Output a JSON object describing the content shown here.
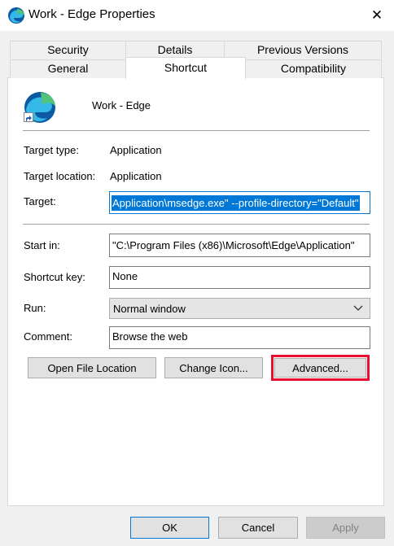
{
  "window": {
    "title": "Work - Edge Properties",
    "close_glyph": "✕",
    "icons": [
      "edge-icon",
      "close-icon",
      "shortcut-arrow-icon",
      "chevron-down-icon"
    ]
  },
  "tabs": {
    "row1": [
      "Security",
      "Details",
      "Previous Versions"
    ],
    "row2": [
      "General",
      "Shortcut",
      "Compatibility"
    ],
    "active": "Shortcut"
  },
  "shortcut": {
    "name": "Work - Edge",
    "target_type_label": "Target type:",
    "target_type_value": "Application",
    "target_location_label": "Target location:",
    "target_location_value": "Application",
    "target_label": "Target:",
    "target_value": "Application\\msedge.exe\" --profile-directory=\"Default\"",
    "start_in_label": "Start in:",
    "start_in_value": "\"C:\\Program Files (x86)\\Microsoft\\Edge\\Application\"",
    "shortcut_key_label": "Shortcut key:",
    "shortcut_key_value": "None",
    "run_label": "Run:",
    "run_value": "Normal window",
    "comment_label": "Comment:",
    "comment_value": "Browse the web"
  },
  "buttons": {
    "open_file_location": "Open File Location",
    "change_icon": "Change Icon...",
    "advanced": "Advanced...",
    "ok": "OK",
    "cancel": "Cancel",
    "apply": "Apply"
  },
  "colors": {
    "selection": "#0078d7",
    "highlight_box": "#e8112d",
    "edge_blue": "#0c59a4",
    "edge_green": "#52c47a"
  }
}
